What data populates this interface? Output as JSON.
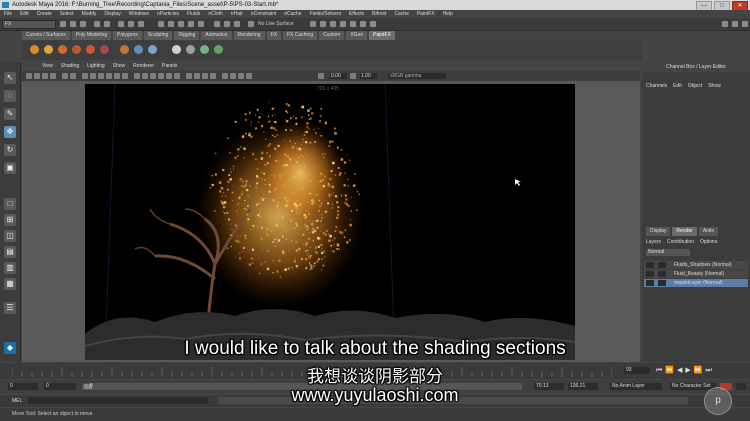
{
  "window": {
    "title": "Autodesk Maya 2016: F:\\Burning_Tree\\Recording\\Captania_Files\\Scene_asset\\P-5\\PS-03-Start.mb*",
    "buttons": [
      "—",
      "□",
      "✕"
    ]
  },
  "menubar": [
    "File",
    "Edit",
    "Create",
    "Select",
    "Modify",
    "Display",
    "Windows",
    "nParticles",
    "Fluids",
    "nCloth",
    "nHair",
    "nConstraint",
    "nCache",
    "Fields/Solvers",
    "Effects",
    "Bifrost",
    "Cache",
    "PaintFX",
    "Help"
  ],
  "statusline": {
    "mode": "FX",
    "no_live_surface": "No Live Surface"
  },
  "shelf_tabs": [
    {
      "label": "Curves / Surfaces",
      "active": false
    },
    {
      "label": "Poly Modeling",
      "active": false
    },
    {
      "label": "Polygons",
      "active": false
    },
    {
      "label": "Sculpting",
      "active": false
    },
    {
      "label": "Rigging",
      "active": false
    },
    {
      "label": "Animation",
      "active": false
    },
    {
      "label": "Rendering",
      "active": false
    },
    {
      "label": "FX",
      "active": false
    },
    {
      "label": "FX Caching",
      "active": false
    },
    {
      "label": "Custom",
      "active": false
    },
    {
      "label": "XGen",
      "active": false
    },
    {
      "label": "PaintFX",
      "active": true
    }
  ],
  "viewport": {
    "menu": [
      "View",
      "Shading",
      "Lighting",
      "Show",
      "Renderer",
      "Panels"
    ],
    "field1": "0.00",
    "field2": "1.00",
    "colorspace": "sRGB gamma",
    "resolution": "720 x 405"
  },
  "channelbox": {
    "title": "Channel Box / Layer Editor",
    "menu": [
      "Channels",
      "Edit",
      "Object",
      "Show"
    ],
    "tabs": [
      {
        "label": "Display",
        "active": false
      },
      {
        "label": "Render",
        "active": true
      },
      {
        "label": "Anim",
        "active": false
      }
    ],
    "submenu": [
      "Layers",
      "Contribution",
      "Options"
    ],
    "mode": "Normal",
    "layers": [
      {
        "name": "Fluids_Shadows (Normal)",
        "active": false
      },
      {
        "name": "Fluid_Beauty (Normal)",
        "active": false
      },
      {
        "name": "masterLayer (Normal)",
        "active": true
      }
    ]
  },
  "timeline": {
    "current_frame": "93",
    "playback": [
      "⏮",
      "⏪",
      "◀",
      "▶",
      "⏩",
      "⏭"
    ]
  },
  "range": {
    "start": "0",
    "playback_start": "0",
    "range_start": "0",
    "range_end": "70.13",
    "end": "136.21",
    "anim_layer": "No Anim Layer",
    "character_set": "No Character Set"
  },
  "command": {
    "label": "MEL"
  },
  "help": {
    "text": "Move Tool: Select an object to move."
  },
  "subtitles": {
    "english": "I would like to talk about the shading sections",
    "chinese": "我想谈谈阴影部分",
    "url": "www.yuyulaoshi.com"
  },
  "colors": {
    "accent": "#5c8fb8",
    "particle": "#f5a030",
    "background": "#444444"
  }
}
